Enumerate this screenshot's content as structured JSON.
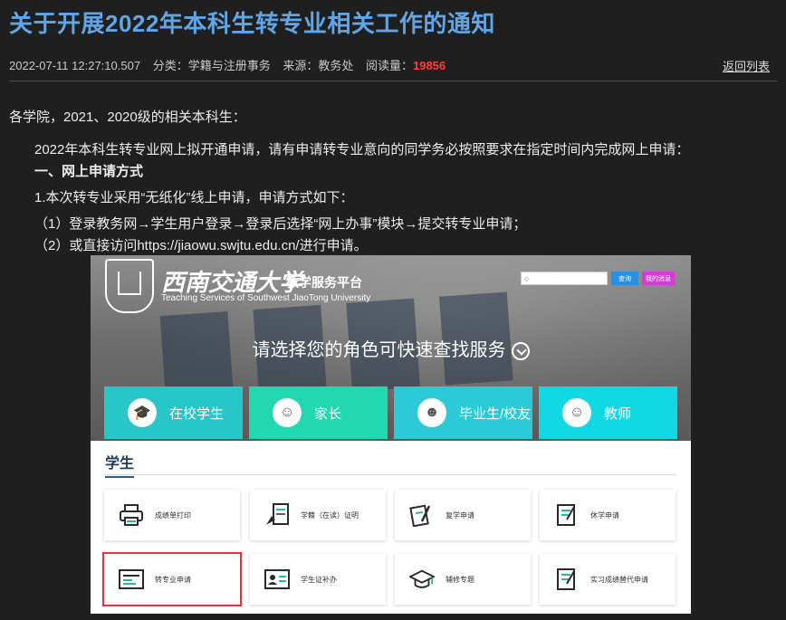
{
  "article": {
    "title": "关于开展2022年本科生转专业相关工作的通知",
    "meta": {
      "datetime": "2022-07-11 12:27:10.507",
      "category": "分类：学籍与注册事务",
      "source": "来源：教务处",
      "reads_label": "阅读量：",
      "reads_value": "19856"
    },
    "back_link": "返回列表",
    "paragraphs": {
      "greeting": "各学院，2021、2020级的相关本科生：",
      "intro": "2022年本科生转专业网上拟开通申请，请有申请转专业意向的同学务必按照要求在指定时间内完成网上申请：",
      "section1": "一、网上申请方式",
      "item1": "1.本次转专业采用“无纸化”线上申请，申请方式如下：",
      "step1": "（1）登录教务网→学生用户登录→登录后选择“网上办事”模块→提交转专业申请；",
      "step2": "（2）或直接访问https://jiaowu.swjtu.edu.cn/进行申请。"
    }
  },
  "screenshot": {
    "brand_cn": "西南交通大学",
    "brand_sub": "教学服务平台",
    "brand_en": "Teaching Services of Southwest JiaoTong University",
    "search_btn": "查询",
    "msg_btn": "我的消息",
    "prompt": "请选择您的角色可快速查找服务",
    "roles": [
      {
        "label": "在校学生",
        "color": "#26c6c9",
        "icon": "graduation-cap-icon"
      },
      {
        "label": "家长",
        "color": "#22d8b0",
        "icon": "parent-icon"
      },
      {
        "label": "毕业生/校友",
        "color": "#2bcad6",
        "icon": "graduate-icon"
      },
      {
        "label": "教师",
        "color": "#10d9e3",
        "icon": "teacher-icon"
      }
    ],
    "section_title": "学生",
    "services": [
      {
        "label": "成绩单打印",
        "icon": "printer-icon"
      },
      {
        "label": "学籍（在读）证明",
        "icon": "certificate-icon"
      },
      {
        "label": "复学申请",
        "icon": "document-pen-icon"
      },
      {
        "label": "休学申请",
        "icon": "form-icon"
      },
      {
        "label": "转专业申请",
        "icon": "id-card-icon"
      },
      {
        "label": "学生证补办",
        "icon": "student-card-icon"
      },
      {
        "label": "辅修专题",
        "icon": "mortarboard-icon"
      },
      {
        "label": "实习成绩替代申请",
        "icon": "form-check-icon"
      }
    ],
    "highlight_color": "#e53333"
  }
}
